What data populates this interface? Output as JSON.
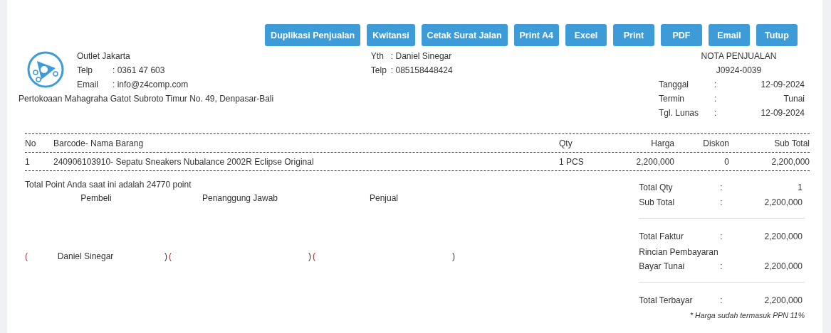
{
  "buttons": [
    "Duplikasi Penjualan",
    "Kwitansi",
    "Cetak Surat Jalan",
    "Print A4",
    "Excel",
    "Print",
    "PDF",
    "Email",
    "Tutup"
  ],
  "outlet": {
    "name": "Outlet Jakarta",
    "fields": [
      {
        "label": "Telp",
        "value": ": 0361 47 603"
      },
      {
        "label": "Email",
        "value": ": info@z4comp.com"
      }
    ],
    "address": "Pertokoaan Mahagraha Gatot Subroto Timur No. 49, Denpasar-Bali"
  },
  "customer": [
    {
      "label": "Yth",
      "value": ": Daniel Sinegar"
    },
    {
      "label": "Telp",
      "value": ": 085158448424"
    }
  ],
  "nota": {
    "title": "NOTA PENJUALAN",
    "number": "J0924-0039",
    "fields": [
      {
        "label": "Tanggal",
        "sep": ":",
        "value": "12-09-2024"
      },
      {
        "label": "Termin",
        "sep": ":",
        "value": "Tunai"
      },
      {
        "label": "Tgl. Lunas",
        "sep": ":",
        "value": "12-09-2024"
      }
    ]
  },
  "table": {
    "columns": [
      "No",
      "Barcode- Nama Barang",
      "Qty",
      "Harga",
      "Diskon",
      "Sub Total"
    ],
    "rows": [
      [
        "1",
        "240906103910- Sepatu Sneakers Nubalance 2002R Eclipse Original",
        "1 PCS",
        "2,200,000",
        "0",
        "2,200,000"
      ]
    ]
  },
  "points": "Total Point Anda saat ini adalah 24770 point",
  "signatures": [
    {
      "label": "Pembeli",
      "open": "(",
      "name": "Daniel Sinegar",
      "close": ")"
    },
    {
      "label": "Penanggung Jawab",
      "open": "(",
      "close": ")"
    },
    {
      "label": "Penjual",
      "open": "(",
      "close": ")"
    }
  ],
  "summary": [
    {
      "kind": "row",
      "label": "Total Qty",
      "sep": ":",
      "value": "1"
    },
    {
      "kind": "row",
      "label": "Sub Total",
      "sep": ":",
      "value": "2,200,000"
    },
    {
      "kind": "divider"
    },
    {
      "kind": "row",
      "label": "Total Faktur",
      "sep": ":",
      "value": "2,200,000"
    },
    {
      "kind": "heading",
      "label": "Rincian Pembayaran"
    },
    {
      "kind": "row",
      "label": "Bayar Tunai",
      "sep": ":",
      "value": "2,200,000"
    },
    {
      "kind": "divider"
    },
    {
      "kind": "row",
      "label": "Total Terbayar",
      "sep": ":",
      "value": "2,200,000"
    }
  ],
  "note": "* Harga sudah termasuk PPN 11%"
}
